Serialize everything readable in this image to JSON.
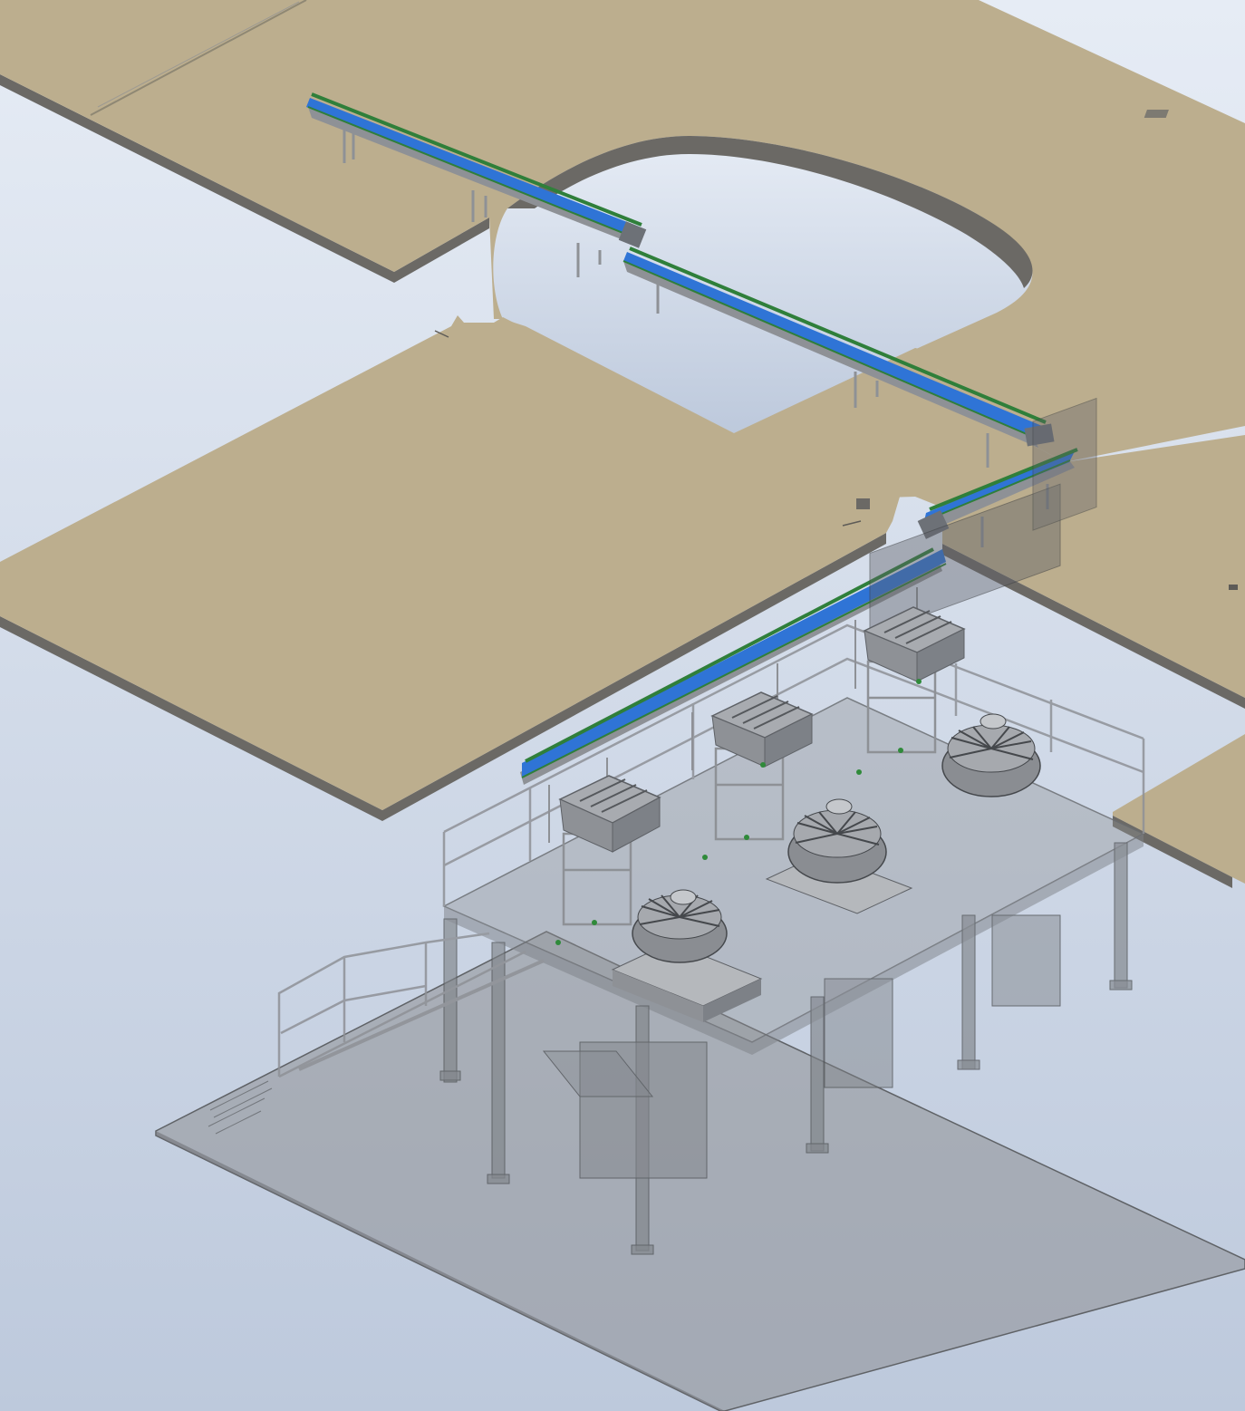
{
  "view": {
    "background_top": "#e6ecf5",
    "background_bottom": "#bdc9dc"
  },
  "colors": {
    "floor_top": "#bcae8e",
    "floor_edge": "#6b6965",
    "floor_line": "#8f8874",
    "belt_blue": "#2f74d6",
    "belt_green": "#2f7f3a",
    "frame_steel": "#8e9196",
    "ghost_steel": "#7d8187",
    "base_plate": "#8e9094"
  },
  "scene": {
    "floors": [
      "upper-floor-slab",
      "middle-floor-slab",
      "right-floor-slab",
      "corner-floor-slab"
    ],
    "conveyors": [
      "conveyor-1",
      "conveyor-2",
      "conveyor-3",
      "conveyor-4"
    ],
    "weighers": [
      "multihead-weigher-1",
      "multihead-weigher-2",
      "multihead-weigher-3"
    ],
    "hoppers": [
      "feed-hopper-1",
      "feed-hopper-2",
      "feed-hopper-3"
    ]
  }
}
